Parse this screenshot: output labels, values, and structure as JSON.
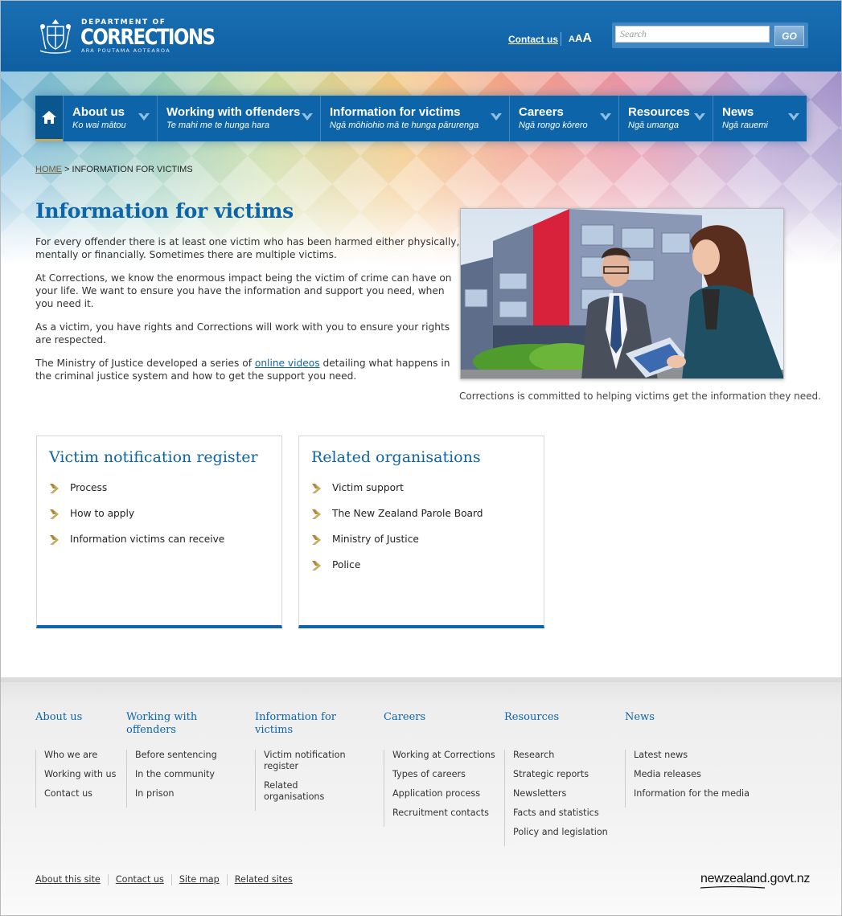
{
  "header": {
    "logo": {
      "dept": "DEPARTMENT OF",
      "name": "CORRECTIONS",
      "sub": "ARA POUTAMA AOTEAROA"
    },
    "contact_label": "Contact us",
    "text_size": {
      "small": "A",
      "medium": "A",
      "large": "A"
    },
    "search": {
      "placeholder": "Search",
      "value": "",
      "go_label": "GO"
    }
  },
  "nav": {
    "home_icon": "home-icon",
    "items": [
      {
        "title": "About us",
        "sub": "Ko wai mātou"
      },
      {
        "title": "Working with offenders",
        "sub": "Te mahi me te hunga hara"
      },
      {
        "title": "Information for victims",
        "sub": "Ngā mōhiohio mā te hunga pārurenga"
      },
      {
        "title": "Careers",
        "sub": "Ngā rongo kōrero"
      },
      {
        "title": "Resources",
        "sub": "Ngā umanga"
      },
      {
        "title": "News",
        "sub": "Ngā rauemi"
      }
    ]
  },
  "breadcrumb": {
    "home": "HOME",
    "sep": " > ",
    "current": "INFORMATION FOR VICTIMS"
  },
  "main": {
    "title": "Information for victims",
    "paragraphs": [
      "For every offender there is at least one victim who has been harmed either physically, mentally or financially. Sometimes there are multiple victims.",
      "At Corrections, we know the enormous impact being the victim of crime can have on your life. We want to ensure you have the information and support you need, when you need it.",
      "As a victim, you have rights and Corrections will work with you to ensure your rights are respected."
    ],
    "p4_before": "The Ministry of Justice developed a series of ",
    "p4_link": "online videos",
    "p4_after": " detailing what happens in the criminal justice system and how to get the support you need.",
    "caption": "Corrections is committed to helping victims get the information they need."
  },
  "cards": [
    {
      "title": "Victim notification register",
      "items": [
        "Process",
        "How to apply",
        "Information victims can receive"
      ]
    },
    {
      "title": "Related organisations",
      "items": [
        "Victim support",
        "The New Zealand Parole Board",
        "Ministry of Justice",
        "Police"
      ]
    }
  ],
  "footer": {
    "columns": [
      {
        "title": "About us",
        "items": [
          "Who we are",
          "Working with us",
          "Contact us"
        ]
      },
      {
        "title": "Working with offenders",
        "items": [
          "Before sentencing",
          "In the community",
          "In prison"
        ]
      },
      {
        "title": "Information for victims",
        "items": [
          "Victim notification register",
          "Related organisations"
        ]
      },
      {
        "title": "Careers",
        "items": [
          "Working at Corrections",
          "Types of careers",
          "Application process",
          "Recruitment contacts"
        ]
      },
      {
        "title": "Resources",
        "items": [
          "Research",
          "Strategic reports",
          "Newsletters",
          "Facts and statistics",
          "Policy and legislation"
        ]
      },
      {
        "title": "News",
        "items": [
          "Latest news",
          "Media releases",
          "Information for the media"
        ]
      }
    ],
    "bottom_links": [
      "About this site",
      "Contact us",
      "Site map",
      "Related sites"
    ],
    "govt_logo": "newzealand.govt.nz"
  },
  "colors": {
    "brand_blue": "#0d64a8",
    "accent_gold": "#c9a95e"
  }
}
